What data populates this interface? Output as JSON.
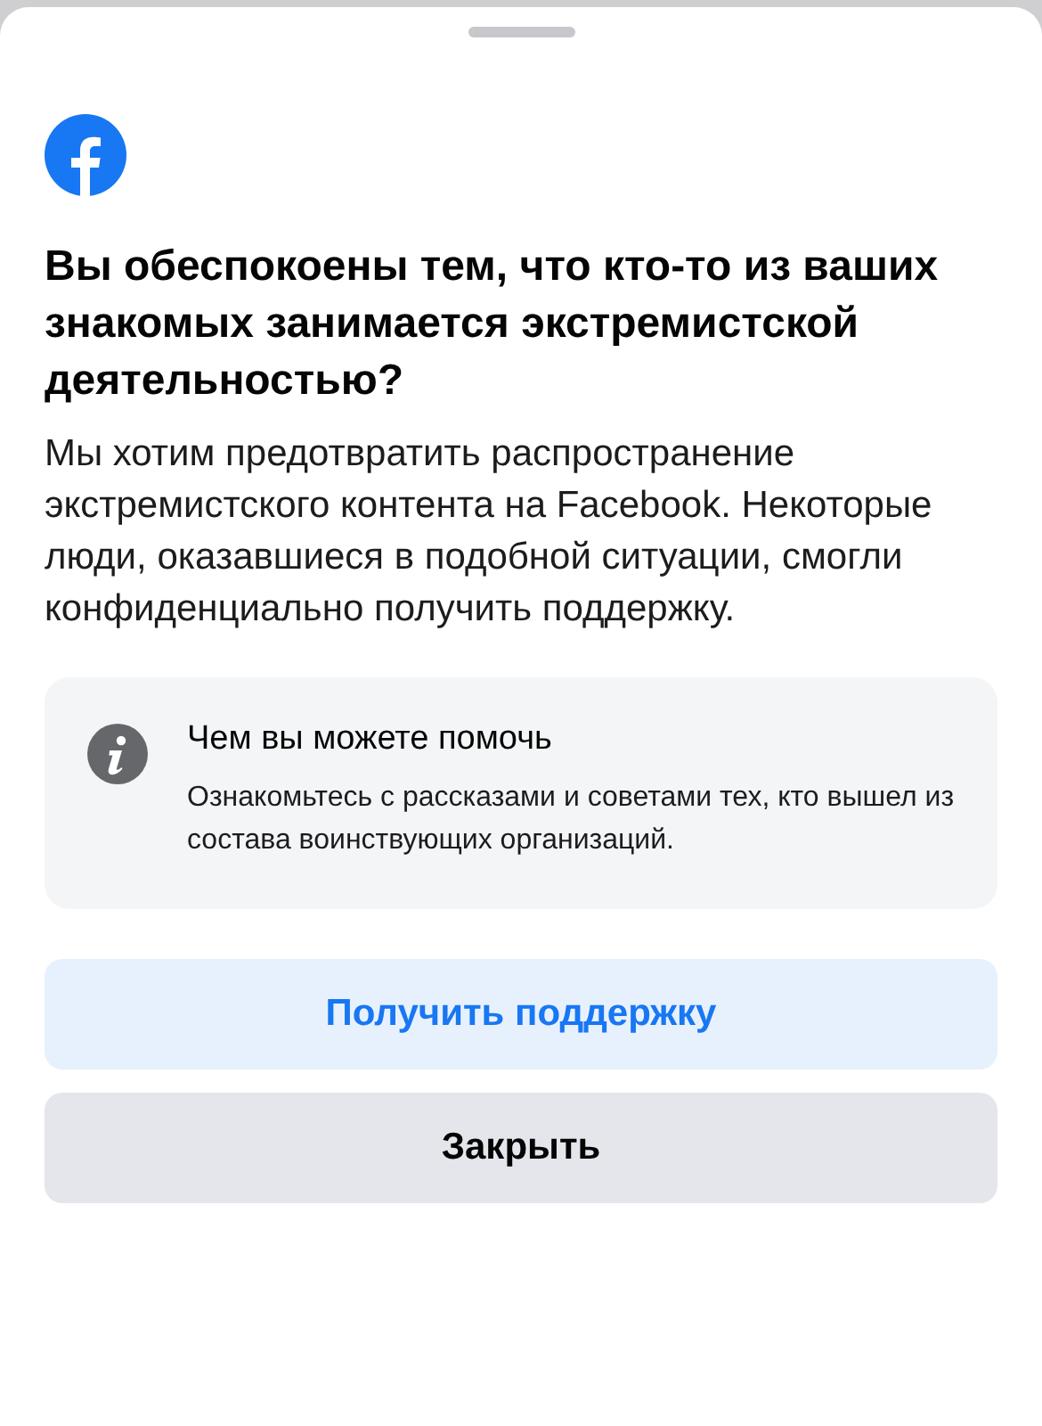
{
  "title": "Вы обеспокоены тем, что кто-то из ваших знакомых занимается экстремистской деятельностью?",
  "body": "Мы хотим предотвратить распространение экстремистского контента на Facebook. Некоторые люди, оказавшиеся в подобной ситуации, смогли конфиденциально получить поддержку.",
  "info_card": {
    "heading": "Чем вы можете помочь",
    "text": "Ознакомьтесь с рассказами и советами тех, кто вышел из состава воинствующих организаций."
  },
  "buttons": [
    {
      "label": "Получить поддержку",
      "kind": "primary"
    },
    {
      "label": "Закрыть",
      "kind": "secondary"
    }
  ]
}
